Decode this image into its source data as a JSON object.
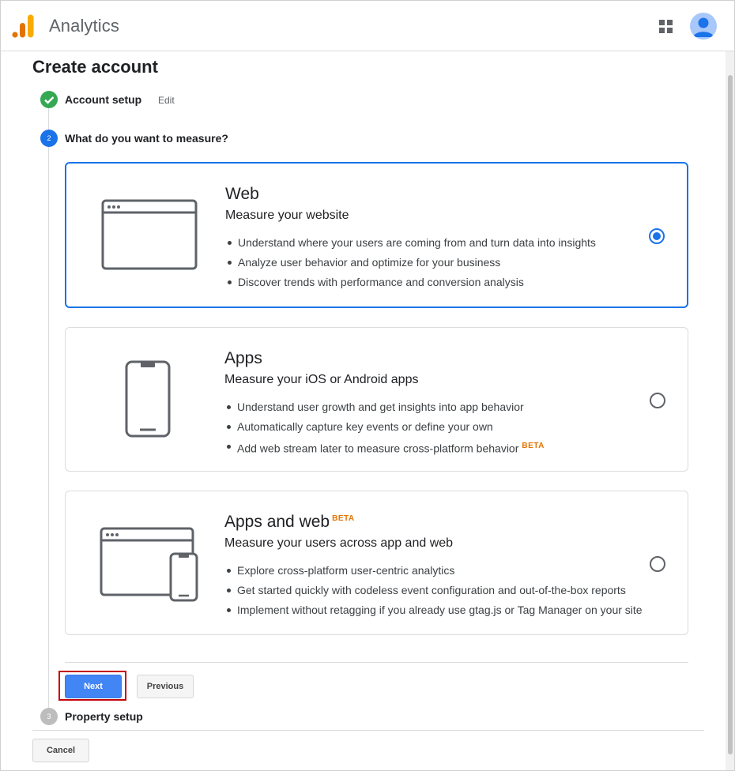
{
  "header": {
    "app_title": "Analytics",
    "apps_icon": "apps-grid-icon",
    "avatar_icon": "account-avatar-icon"
  },
  "page": {
    "title": "Create account"
  },
  "steps": [
    {
      "number": "1",
      "label": "Account setup",
      "status": "done",
      "edit_label": "Edit"
    },
    {
      "number": "2",
      "label": "What do you want to measure?",
      "status": "active"
    },
    {
      "number": "3",
      "label": "Property setup",
      "status": "pending"
    }
  ],
  "options": [
    {
      "title": "Web",
      "subtitle": "Measure your website",
      "bullets": [
        "Understand where your users are coming from and turn data into insights",
        "Analyze user behavior and optimize for your business",
        "Discover trends with performance and conversion analysis"
      ],
      "selected": true,
      "icon": "browser-window-icon"
    },
    {
      "title": "Apps",
      "subtitle": "Measure your iOS or Android apps",
      "bullets": [
        "Understand user growth and get insights into app behavior",
        "Automatically capture key events or define your own",
        "Add web stream later to measure cross-platform behavior"
      ],
      "bullet_badge": "BETA",
      "selected": false,
      "icon": "mobile-phone-icon"
    },
    {
      "title": "Apps and web",
      "title_badge": "BETA",
      "subtitle": "Measure your users across app and web",
      "bullets": [
        "Explore cross-platform user-centric analytics",
        "Get started quickly with codeless event configuration and out-of-the-box reports",
        "Implement without retagging if you already use gtag.js or Tag Manager on your site"
      ],
      "selected": false,
      "icon": "browser-and-phone-icon"
    }
  ],
  "buttons": {
    "next": "Next",
    "previous": "Previous",
    "cancel": "Cancel"
  },
  "colors": {
    "accent": "#1a73e8",
    "step_done": "#34a853",
    "next_button": "#4285f4",
    "beta": "#e37400",
    "highlight": "#c5050c"
  }
}
